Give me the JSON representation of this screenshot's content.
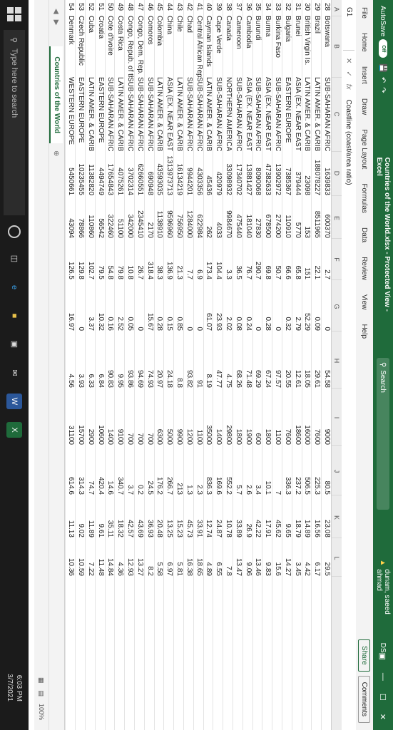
{
  "titlebar": {
    "autosave_label": "AutoSave",
    "autosave_state": "Off",
    "document_title": "Countries of the World.xlsx  -  Protected View  -  Excel",
    "search_placeholder": "Search",
    "warning_user": "dunam, saeed ahmad",
    "user_initials": "DS"
  },
  "ribbon": {
    "tabs": [
      "File",
      "Home",
      "Insert",
      "Draw",
      "Page Layout",
      "Formulas",
      "Data",
      "Review",
      "View",
      "Help"
    ],
    "share_label": "Share",
    "comments_label": "Comments"
  },
  "formula_bar": {
    "name_box": "G1",
    "content": "Coastline (coast/area ratio)"
  },
  "columns": [
    "A",
    "B",
    "C",
    "D",
    "E",
    "F",
    "G",
    "H",
    "I",
    "J",
    "K",
    "L"
  ],
  "rows": [
    [
      "28",
      "Botswana",
      "SUB-SAHARAN AFRICA",
      "1639833",
      "600370",
      "2.7",
      "0",
      "54.58",
      "9000",
      "80.5",
      "23.08",
      "29.5"
    ],
    [
      "29",
      "Brazil",
      "LATIN AMER. & CARIB",
      "188078227",
      "8511965",
      "22.1",
      "0.09",
      "29.61",
      "7600",
      "225.3",
      "16.56",
      "6.17"
    ],
    [
      "30",
      "British Virgin Is.",
      "LATIN AMER. & CARIB",
      "23098",
      "153",
      "151",
      "52.29",
      "18.05",
      "16000",
      "506.5",
      "14.89",
      "4.42"
    ],
    [
      "31",
      "Brunei",
      "ASIA (EX. NEAR EAST)",
      "379444",
      "5770",
      "65.8",
      "2.79",
      "12.61",
      "18600",
      "237.2",
      "18.79",
      "3.45"
    ],
    [
      "32",
      "Bulgaria",
      "EASTERN EUROPE",
      "7385367",
      "110910",
      "66.6",
      "0.32",
      "20.55",
      "7600",
      "336.3",
      "9.65",
      "14.27"
    ],
    [
      "33",
      "Burkina Faso",
      "SUB-SAHARAN AFRICA",
      "13902972",
      "274200",
      "50.7",
      "0",
      "97.57",
      "1100",
      "7",
      "45.62",
      "15.6"
    ],
    [
      "34",
      "Burma",
      "ASIA (EX. NEAR EAST)",
      "47382633",
      "678500",
      "69.8",
      "0.28",
      "67.24",
      "1800",
      "10.1",
      "17.91",
      "9.83"
    ],
    [
      "35",
      "Burundi",
      "SUB-SAHARAN AFRICA",
      "8090068",
      "27830",
      "290.7",
      "0",
      "69.29",
      "600",
      "3.4",
      "42.22",
      "13.46"
    ],
    [
      "36",
      "Cambodia",
      "ASIA (EX. NEAR EAST)",
      "13881427",
      "181040",
      "76.7",
      "0.24",
      "71.48",
      "1900",
      "2.6",
      "26.9",
      "9.06"
    ],
    [
      "37",
      "Cameroon",
      "SUB-SAHARAN AFRICA",
      "17340702",
      "475440",
      "36.5",
      "0.08",
      "68.26",
      "1800",
      "5.7",
      "33.89",
      "13.47"
    ],
    [
      "38",
      "Canada",
      "NORTHERN AMERICA",
      "33098932",
      "9984670",
      "3.3",
      "2.02",
      "4.75",
      "29800",
      "552.2",
      "10.78",
      "7.8"
    ],
    [
      "39",
      "Cape Verde",
      "SUB-SAHARAN AFRICA",
      "420979",
      "4033",
      "104.4",
      "23.93",
      "47.77",
      "1400",
      "169.6",
      "24.87",
      "6.55"
    ],
    [
      "40",
      "Cayman Islands",
      "LATIN AMER. & CARIB",
      "45436",
      "262",
      "173.4",
      "61.07",
      "8.19",
      "35000",
      "836.3",
      "12.74",
      "4.89"
    ],
    [
      "41",
      "Central African Rep.",
      "SUB-SAHARAN AFRICA",
      "4303356",
      "622984",
      "6.9",
      "0",
      "91",
      "1100",
      "2.3",
      "33.91",
      "18.65"
    ],
    [
      "42",
      "Chad",
      "SUB-SAHARAN AFRICA",
      "9944201",
      "1284000",
      "7.7",
      "0",
      "93.82",
      "1200",
      "1.3",
      "45.73",
      "16.38"
    ],
    [
      "43",
      "Chile",
      "LATIN AMER. & CARIB",
      "16134219",
      "756950",
      "21.3",
      "0.85",
      "8.8",
      "9900",
      "213",
      "15.23",
      "5.81"
    ],
    [
      "44",
      "China",
      "ASIA (EX. NEAR EAST)",
      "1313973713",
      "9596960",
      "136.9",
      "0.15",
      "24.18",
      "5000",
      "266.7",
      "13.25",
      "6.97"
    ],
    [
      "45",
      "Colombia",
      "LATIN AMER. & CARIB",
      "43593035",
      "1138910",
      "38.3",
      "0.28",
      "20.97",
      "6300",
      "176.2",
      "20.48",
      "5.58"
    ],
    [
      "46",
      "Comoros",
      "SUB-SAHARAN AFRICA",
      "690948",
      "2170",
      "318.4",
      "15.67",
      "74.93",
      "700",
      "24.5",
      "36.93",
      "8.2"
    ],
    [
      "47",
      "Congo, Dem. Rep.",
      "SUB-SAHARAN AFRICA",
      "62660551",
      "2345410",
      "26.7",
      "0",
      "94.69",
      "700",
      "0.2",
      "43.69",
      "13.27"
    ],
    [
      "48",
      "Congo, Repub. of the",
      "SUB-SAHARAN AFRICA",
      "3702314",
      "342000",
      "10.8",
      "0.05",
      "93.86",
      "700",
      "3.7",
      "42.57",
      "12.93"
    ],
    [
      "49",
      "Costa Rica",
      "LATIN AMER. & CARIB",
      "4075261",
      "51100",
      "79.8",
      "2.52",
      "9.95",
      "9100",
      "340.7",
      "18.32",
      "4.36"
    ],
    [
      "50",
      "Cote d'Ivoire",
      "SUB-SAHARAN AFRICA",
      "17654843",
      "322460",
      "54.8",
      "0.16",
      "90.83",
      "1400",
      "14.6",
      "35.11",
      "14.84"
    ],
    [
      "51",
      "Croatia",
      "EASTERN EUROPE",
      "4494749",
      "56542",
      "79.5",
      "10.32",
      "6.84",
      "10600",
      "420.4",
      "9.61",
      "11.48"
    ],
    [
      "52",
      "Cuba",
      "LATIN AMER. & CARIB",
      "11382820",
      "110860",
      "102.7",
      "3.37",
      "6.33",
      "2900",
      "74.7",
      "11.89",
      "7.22"
    ],
    [
      "53",
      "Czech Republic",
      "EASTERN EUROPE",
      "10235455",
      "78866",
      "129.8",
      "0",
      "3.93",
      "15700",
      "314.3",
      "9.02",
      "10.59"
    ],
    [
      "54",
      "Denmark",
      "WESTERN EUROPE",
      "5450661",
      "43094",
      "126.5",
      "16.97",
      "4.56",
      "31100",
      "614.6",
      "11.13",
      "10.36"
    ]
  ],
  "sheet_tab": "Countries of the World",
  "status": {
    "zoom": "100%"
  },
  "taskbar": {
    "search_placeholder": "Type here to search",
    "time": "6:03 PM",
    "date": "3/7/2021"
  },
  "colors": {
    "excel_green": "#1f6b3b",
    "taskbar": "#1b1b1b"
  }
}
